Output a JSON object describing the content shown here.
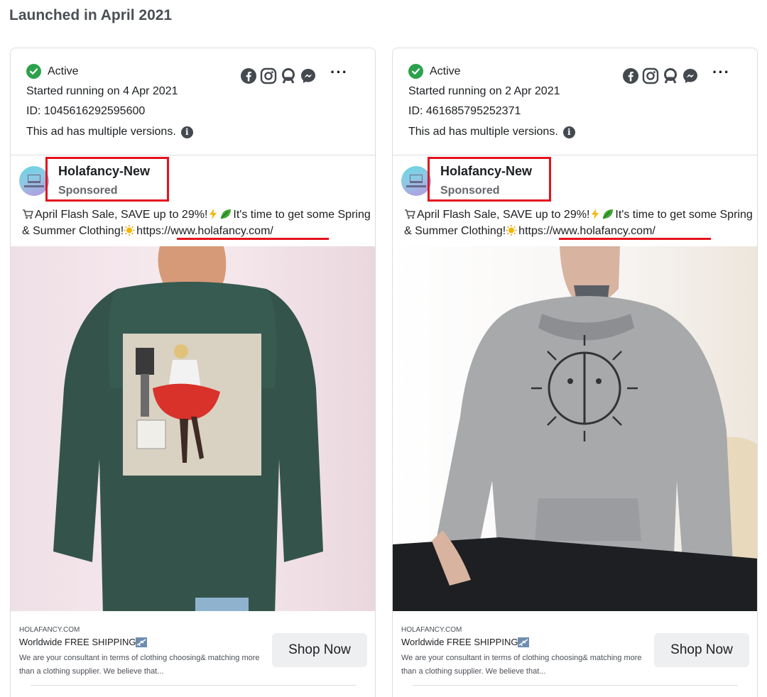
{
  "section_title": "Launched in April 2021",
  "colors": {
    "active_green": "#2ba24c",
    "highlight_red": "#e3121d",
    "card_border": "#dadde1"
  },
  "platform_icons": [
    "facebook-icon",
    "instagram-icon",
    "audience-network-icon",
    "messenger-icon"
  ],
  "cards": [
    {
      "status": "Active",
      "started": "Started running on 4 Apr 2021",
      "id_line": "ID: 1045616292595600",
      "versions": "This ad has multiple versions.",
      "info_glyph": "i",
      "more_label": "···",
      "page_name": "Holafancy-New",
      "sponsored": "Sponsored",
      "copy_part1": "April Flash Sale, SAVE up to 29%!",
      "copy_part2": "It's time to get some Spring & Summer Clothing!",
      "link": "https://www.holafancy.com/",
      "domain": "HOLAFANCY.COM",
      "headline": "Worldwide FREE SHIPPING",
      "description": "We are your consultant in terms of clothing choosing& matching more than a clothing supplier. We believe that...",
      "cta": "Shop Now"
    },
    {
      "status": "Active",
      "started": "Started running on 2 Apr 2021",
      "id_line": "ID: 461685795252371",
      "versions": "This ad has multiple versions.",
      "info_glyph": "i",
      "more_label": "···",
      "page_name": "Holafancy-New",
      "sponsored": "Sponsored",
      "copy_part1": "April Flash Sale, SAVE up to 29%!",
      "copy_part2": "It's time to get some Spring & Summer Clothing!",
      "link": "https://www.holafancy.com/",
      "domain": "HOLAFANCY.COM",
      "headline": "Worldwide FREE SHIPPING",
      "description": "We are your consultant in terms of clothing choosing& matching more than a clothing supplier. We believe that...",
      "cta": "Shop Now"
    }
  ]
}
